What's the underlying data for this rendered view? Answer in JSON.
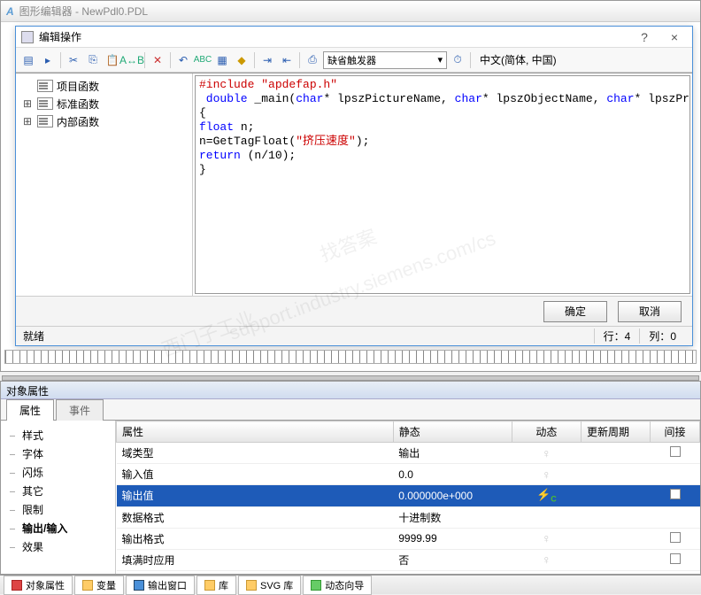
{
  "main_window": {
    "title": "图形编辑器 - NewPdl0.PDL"
  },
  "dialog": {
    "title": "编辑操作",
    "help": "?",
    "close": "×",
    "toolbar": {
      "trigger_combo": "缺省触发器",
      "language": "中文(简体, 中国)"
    },
    "tree": {
      "items": [
        "项目函数",
        "标准函数",
        "内部函数"
      ]
    },
    "code": {
      "l1a": "#include ",
      "l1b": "\"apdefap.h\"",
      "l2a": " double",
      "l2b": " _main(",
      "l2c": "char",
      "l2d": "* lpszPictureName, ",
      "l2e": "char",
      "l2f": "* lpszObjectName, ",
      "l2g": "char",
      "l2h": "* lpszPropertyName)",
      "l3": "{",
      "l4a": "float",
      "l4b": " n;",
      "l5a": "n=GetTagFloat(",
      "l5b": "\"挤压速度\"",
      "l5c": ");",
      "l6a": "return",
      "l6b": " (n/10);",
      "l7": "}"
    },
    "footer": {
      "ok": "确定",
      "cancel": "取消"
    },
    "status": {
      "ready": "就绪",
      "row_label": "行：",
      "row": "4",
      "col_label": "列：",
      "col": "0"
    }
  },
  "props": {
    "panel_title": "对象属性",
    "tabs": {
      "attrs": "属性",
      "events": "事件"
    },
    "categories": [
      "样式",
      "字体",
      "闪烁",
      "其它",
      "限制",
      "输出/输入",
      "效果"
    ],
    "selected_category": "输出/输入",
    "columns": {
      "name": "属性",
      "static": "静态",
      "dynamic": "动态",
      "refresh": "更新周期",
      "indirect": "间接"
    },
    "rows": [
      {
        "name": "域类型",
        "static": "输出",
        "dynamic": "bulb",
        "indirect": true
      },
      {
        "name": "输入值",
        "static": "0.0",
        "dynamic": "bulb",
        "indirect": false
      },
      {
        "name": "输出值",
        "static": "0.000000e+000",
        "dynamic": "bolt",
        "indirect": true,
        "selected": true
      },
      {
        "name": "数据格式",
        "static": "十进制数",
        "dynamic": "",
        "indirect": false
      },
      {
        "name": "输出格式",
        "static": "9999.99",
        "dynamic": "bulb",
        "indirect": true
      },
      {
        "name": "填满时应用",
        "static": "否",
        "dynamic": "bulb",
        "indirect": true
      }
    ]
  },
  "bottom_tabs": [
    "对象属性",
    "变量",
    "输出窗口",
    "库",
    "SVG 库",
    "动态向导"
  ]
}
